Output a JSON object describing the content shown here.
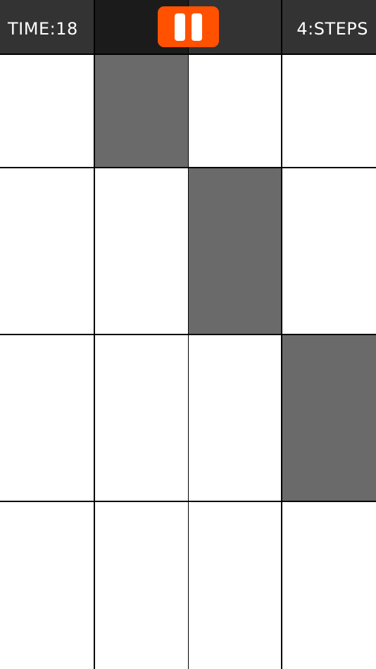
{
  "header": {
    "time_text": "TIME:18",
    "steps_text": "4:STEPS",
    "pause_icon": "pause-icon"
  },
  "colors": {
    "header_bg": "#333333",
    "header_mid": "#1b1b1b",
    "pause_button": "#ff5100",
    "white_tile": "#ffffff",
    "black_tile": "#6a6a6a",
    "grid_line": "#000000"
  },
  "board": {
    "columns": 4,
    "rows": [
      {
        "black_column": 1
      },
      {
        "black_column": 2
      },
      {
        "black_column": 3
      },
      {
        "black_column": null
      }
    ]
  }
}
